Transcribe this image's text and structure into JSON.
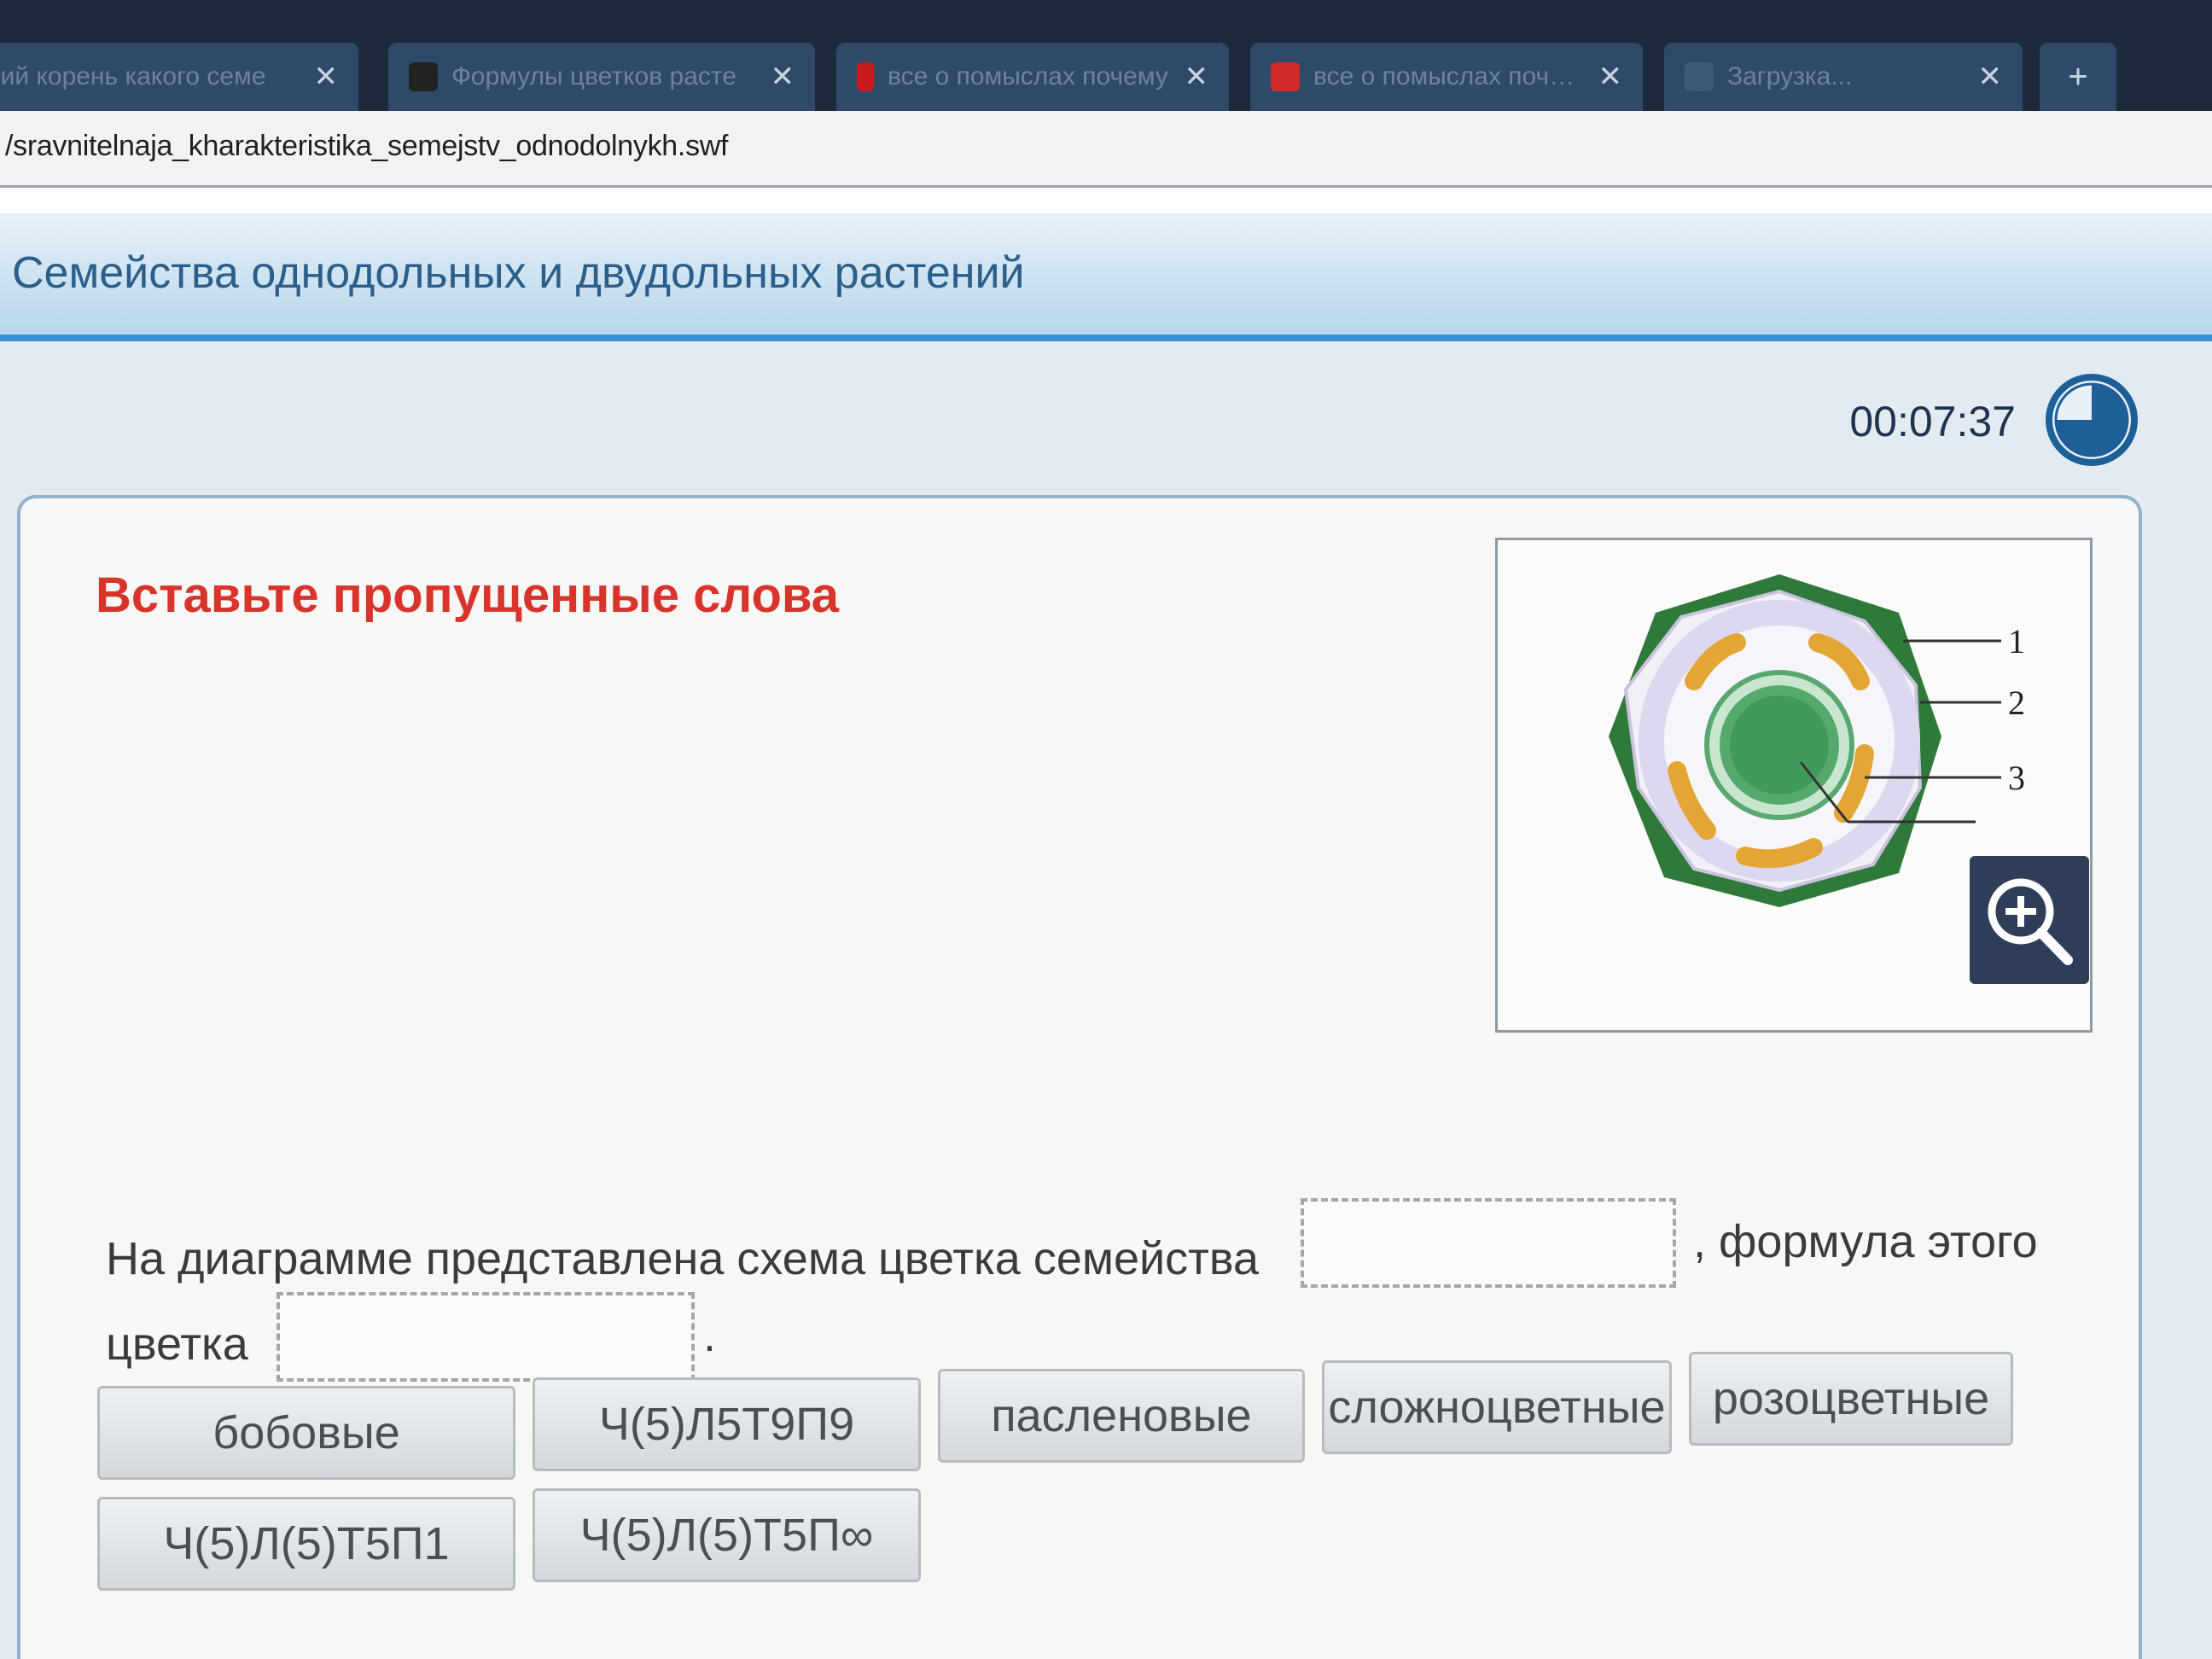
{
  "browser": {
    "tabs": [
      {
        "label": "ний корень какого семе"
      },
      {
        "label": "Формулы цветков расте"
      },
      {
        "label": "все о помыслах почему"
      },
      {
        "label": "все о помыслах почему"
      },
      {
        "label": "Загрузка..."
      }
    ],
    "address": "/sravnitelnaja_kharakteristika_semejstv_odnodolnykh.swf"
  },
  "header": {
    "title": "Семейства однодольных и двудольных растений"
  },
  "timer": {
    "value": "00:07:37"
  },
  "task": {
    "title": "Вставьте пропущенные слова",
    "sentence_part1": "На диаграмме представлена схема цветка семейства",
    "sentence_part2": ", формула этого",
    "sentence_part3": "цветка",
    "sentence_end": "."
  },
  "diagram": {
    "labels": [
      "1",
      "2",
      "3"
    ]
  },
  "answers": [
    "бобовые",
    "Ч(5)Л5Т9П9",
    "пасленовые",
    "сложноцветные",
    "розоцветные",
    "Ч(5)Л(5)Т5П1",
    "Ч(5)Л(5)Т5П∞"
  ],
  "colors": {
    "accent": "#3b8fd0",
    "title_red": "#d8342b",
    "sepal_green": "#2f7a3a",
    "anther_orange": "#e3a534",
    "ovary_green": "#3f9b5a"
  }
}
